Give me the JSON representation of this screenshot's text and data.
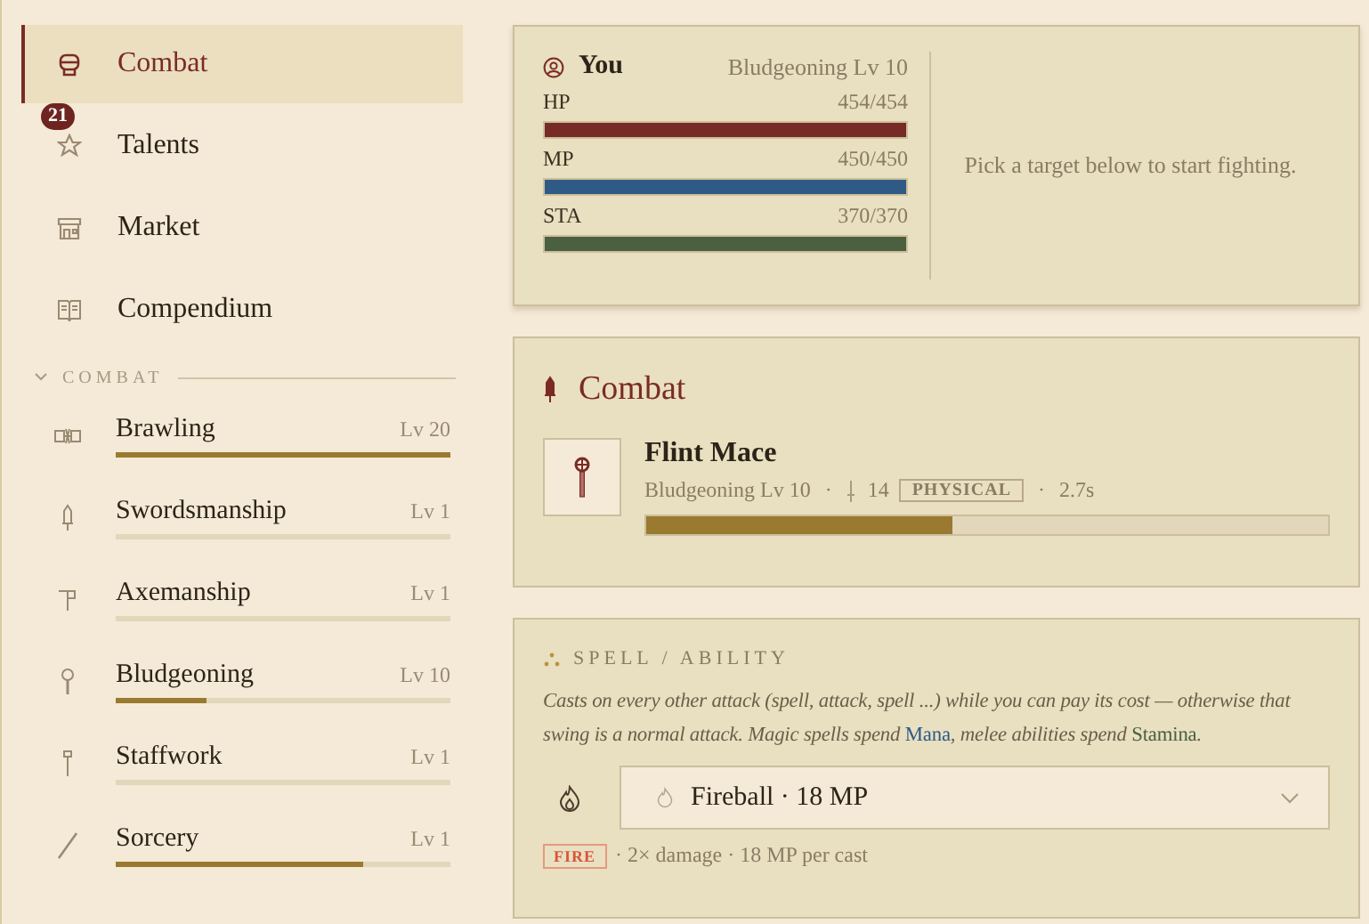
{
  "nav": [
    {
      "label": "Combat",
      "selected": true
    },
    {
      "label": "Talents",
      "selected": false,
      "badge": "21"
    },
    {
      "label": "Market",
      "selected": false
    },
    {
      "label": "Compendium",
      "selected": false
    }
  ],
  "skills_section": {
    "title": "COMBAT",
    "expanded": true
  },
  "skills": [
    {
      "name": "Brawling",
      "level_text": "Lv 20",
      "level": 1.0
    },
    {
      "name": "Swordsmanship",
      "level_text": "Lv 1",
      "level": 0
    },
    {
      "name": "Axemanship",
      "level_text": "Lv 1",
      "level": 0
    },
    {
      "name": "Bludgeoning",
      "level_text": "Lv 10",
      "level": 0.27
    },
    {
      "name": "Staffwork",
      "level_text": "Lv 1",
      "level": 0
    },
    {
      "name": "Sorcery",
      "level_text": "Lv 1",
      "level": 0.74
    }
  ],
  "player": {
    "name": "You",
    "subtitle": "Bludgeoning Lv 10",
    "stats": [
      {
        "label": "HP",
        "reading": "454/454",
        "level": 1.0,
        "color": "#772b26"
      },
      {
        "label": "MP",
        "reading": "450/450",
        "level": 1.0,
        "color": "#2f5a86"
      },
      {
        "label": "STA",
        "reading": "370/370",
        "level": 1.0,
        "color": "#4a6040"
      }
    ],
    "hint": "Pick a target below to start fighting."
  },
  "combat": {
    "title": "Combat",
    "weapon": {
      "name": "Flint Mace",
      "skill": "Bludgeoning Lv 10",
      "damage": "14",
      "damage_type": "PHYSICAL",
      "speed": "2.7s",
      "separators": [
        "·",
        "·"
      ],
      "level": 0.45
    }
  },
  "spell": {
    "title": "SPELL / ABILITY",
    "description": [
      {
        "text": "Casts on every other attack (spell, attack, spell ...) while you can pay its cost — otherwise that swing is a normal attack. Magic spells spend ",
        "kind": "plain"
      },
      {
        "text": "Mana",
        "kind": "resource",
        "color": "#2f5a86"
      },
      {
        "text": ", melee abilities spend ",
        "kind": "plain"
      },
      {
        "text": "Stamina",
        "kind": "resource",
        "color": "#4a6040"
      },
      {
        "text": ".",
        "kind": "plain"
      }
    ],
    "select_value": "Fireball · 18 MP",
    "tag": "FIRE",
    "effect": "· 2× damage · 18 MP per cast"
  }
}
